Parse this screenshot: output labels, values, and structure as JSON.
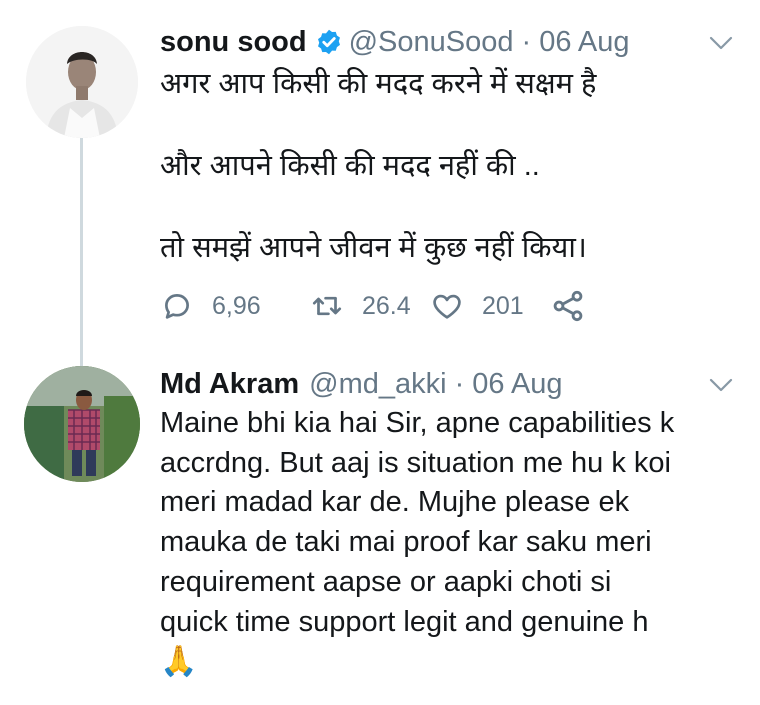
{
  "tweet": {
    "author_name": "sonu sood",
    "author_handle": "@SonuSood",
    "separator": "·",
    "date": "06 Aug",
    "text_lines": [
      "अगर आप किसी की मदद करने में सक्षम है",
      "और आपने किसी की मदद नहीं की ..",
      "तो समझें आपने जीवन में कुछ नहीं किया।"
    ],
    "reply_count": "6,96",
    "retweet_count": "26.4",
    "like_count": "201"
  },
  "reply": {
    "author_name": "Md Akram",
    "author_handle": "@md_akki",
    "separator": "·",
    "date": "06 Aug",
    "text_lines": [
      "Maine bhi kia hai Sir, apne capabilities k",
      "accrdng. But aaj is situation me hu k koi",
      "meri madad kar de. Mujhe please ek",
      "mauka de taki mai proof kar saku meri",
      "requirement aapse or aapki choti si",
      "quick time support legit and genuine h"
    ],
    "emoji": "🙏"
  },
  "icons": {
    "verified": "verified-badge-icon",
    "caret": "chevron-down-icon",
    "reply": "reply-icon",
    "retweet": "retweet-icon",
    "like": "heart-icon",
    "share": "share-icon"
  },
  "colors": {
    "accent": "#1da1f2",
    "muted": "#657786",
    "text": "#14171a",
    "thread_line": "#cfd9de"
  }
}
